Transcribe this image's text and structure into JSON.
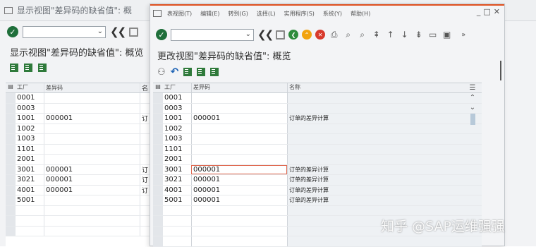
{
  "background_window": {
    "title": "显示视图\"差异码的缺省值\": 概",
    "subtitle": "显示视图\"差异码的缺省值\": 概览",
    "header": {
      "plant": "工厂",
      "code": "差异码",
      "name": "名"
    },
    "rows": [
      {
        "plant": "0001",
        "code": "",
        "name": ""
      },
      {
        "plant": "0003",
        "code": "",
        "name": ""
      },
      {
        "plant": "1001",
        "code": "000001",
        "name": "订"
      },
      {
        "plant": "1002",
        "code": "",
        "name": ""
      },
      {
        "plant": "1003",
        "code": "",
        "name": ""
      },
      {
        "plant": "1101",
        "code": "",
        "name": ""
      },
      {
        "plant": "2001",
        "code": "",
        "name": ""
      },
      {
        "plant": "3001",
        "code": "000001",
        "name": "订"
      },
      {
        "plant": "3021",
        "code": "000001",
        "name": "订"
      },
      {
        "plant": "4001",
        "code": "000001",
        "name": "订"
      },
      {
        "plant": "5001",
        "code": "",
        "name": ""
      },
      {
        "plant": "",
        "code": "",
        "name": ""
      },
      {
        "plant": "",
        "code": "",
        "name": ""
      },
      {
        "plant": "",
        "code": "",
        "name": ""
      }
    ]
  },
  "window": {
    "menu": [
      "表视图(T)",
      "编辑(E)",
      "转到(G)",
      "选择(L)",
      "实用程序(S)",
      "系统(Y)",
      "帮助(H)"
    ],
    "controls": {
      "minimize": "_",
      "maximize": "□",
      "close": "✕"
    },
    "toolbar": {
      "ok": "✓",
      "back": "❮",
      "exit": "⌃",
      "cancel": "✕",
      "more": "»"
    },
    "title": "更改视图\"差异码的缺省值\": 概览",
    "table": {
      "header": {
        "plant": "工厂",
        "code": "差异码",
        "name": "名称"
      },
      "rows": [
        {
          "plant": "0001",
          "code": "",
          "name": ""
        },
        {
          "plant": "0003",
          "code": "",
          "name": ""
        },
        {
          "plant": "1001",
          "code": "000001",
          "name": "订单的差异计算"
        },
        {
          "plant": "1002",
          "code": "",
          "name": ""
        },
        {
          "plant": "1003",
          "code": "",
          "name": ""
        },
        {
          "plant": "1101",
          "code": "",
          "name": ""
        },
        {
          "plant": "2001",
          "code": "",
          "name": ""
        },
        {
          "plant": "3001",
          "code": "000001",
          "name": "订单的差异计算"
        },
        {
          "plant": "3021",
          "code": "000001",
          "name": "订单的差异计算"
        },
        {
          "plant": "4001",
          "code": "000001",
          "name": "订单的差异计算"
        },
        {
          "plant": "5001",
          "code": "000001",
          "name": "订单的差异计算"
        },
        {
          "plant": "",
          "code": "",
          "name": ""
        },
        {
          "plant": "",
          "code": "",
          "name": ""
        },
        {
          "plant": "",
          "code": "",
          "name": ""
        },
        {
          "plant": "",
          "code": "",
          "name": ""
        }
      ]
    }
  },
  "watermark": "知乎 @SAP运维强强",
  "colors": {
    "accent": "#e0501f",
    "ok_green": "#2d8c3c",
    "cancel_red": "#d83a2c",
    "exit_orange": "#f2a30f"
  }
}
